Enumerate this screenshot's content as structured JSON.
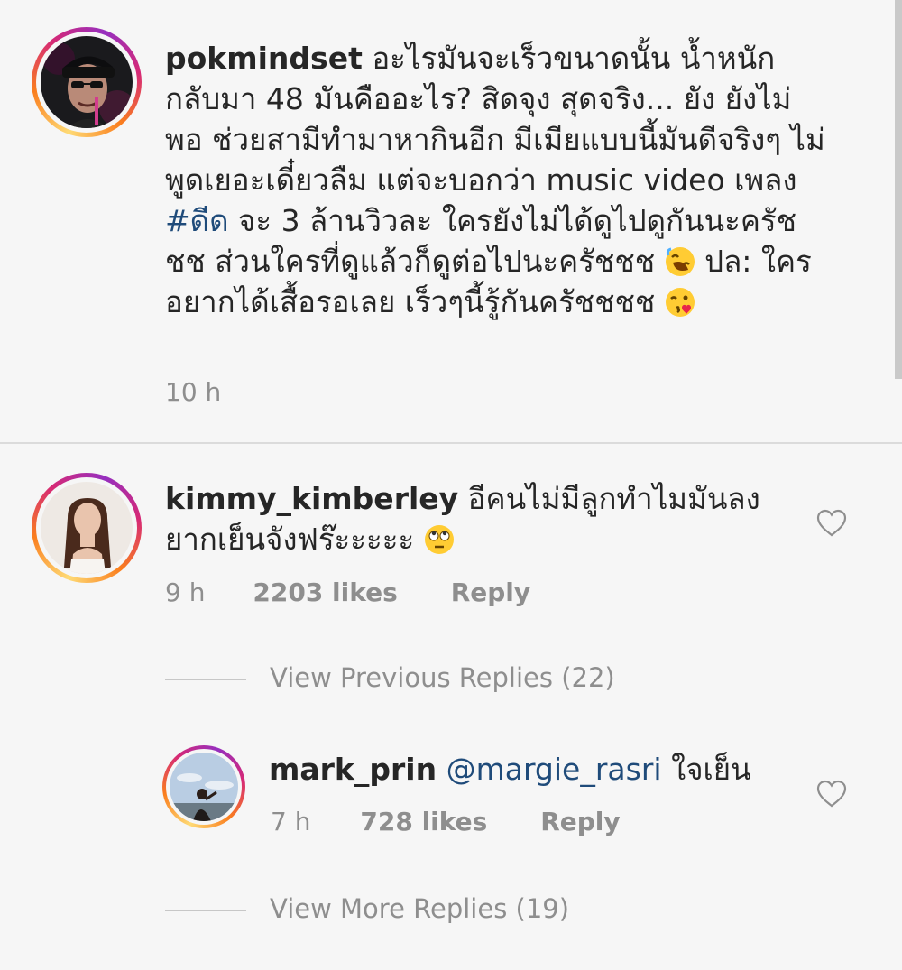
{
  "comments": [
    {
      "username": "pokmindset",
      "text_1": "อะไรมันจะเร็วขนาดนั้น น้ำหนักกลับมา 48 มันคืออะไร? สิดจุง สุดจริง... ยัง ยังไม่พอ ช่วยสามีทำมาหากินอีก มีเมียแบบนี้มันดีจริงๆ ไม่พูดเยอะเดี๋ยวลืม แต่จะบอกว่า music video เพลง",
      "hashtag": "#ดีด",
      "text_2": "จะ 3 ล้านวิวละ ใครยังไม่ได้ดูไปดูกันนะครัชชช ส่วนใครที่ดูแล้วก็ดูต่อไปนะครัชชช",
      "emoji_1": "rolling-on-floor-laughing-emoji",
      "text_3": "ปล: ใครอยากได้เสื้อรอเลย เร็วๆนี้รู้กันครัชชชช",
      "emoji_2": "face-blowing-kiss-emoji",
      "time": "10 h"
    },
    {
      "username": "kimmy_kimberley",
      "text": "อีคนไม่มีลูกทำไมมันลงยากเย็นจังฟร๊ะะะะะ",
      "emoji": "face-with-rolling-eyes-emoji",
      "time": "9 h",
      "likes": "2203 likes",
      "reply": "Reply",
      "liked": false
    },
    {
      "username": "mark_prin",
      "mention": "@margie_rasri",
      "text": "ใจเย็น",
      "time": "7 h",
      "likes": "728 likes",
      "reply": "Reply",
      "liked": false
    }
  ],
  "view_previous_replies": "View Previous Replies (22)",
  "view_more_replies": "View More Replies (19)",
  "colors": {
    "background": "#f6f6f6",
    "text": "#262626",
    "secondary": "#8e8e8e",
    "link": "#1f4b7a",
    "divider": "#dbdbdb"
  }
}
